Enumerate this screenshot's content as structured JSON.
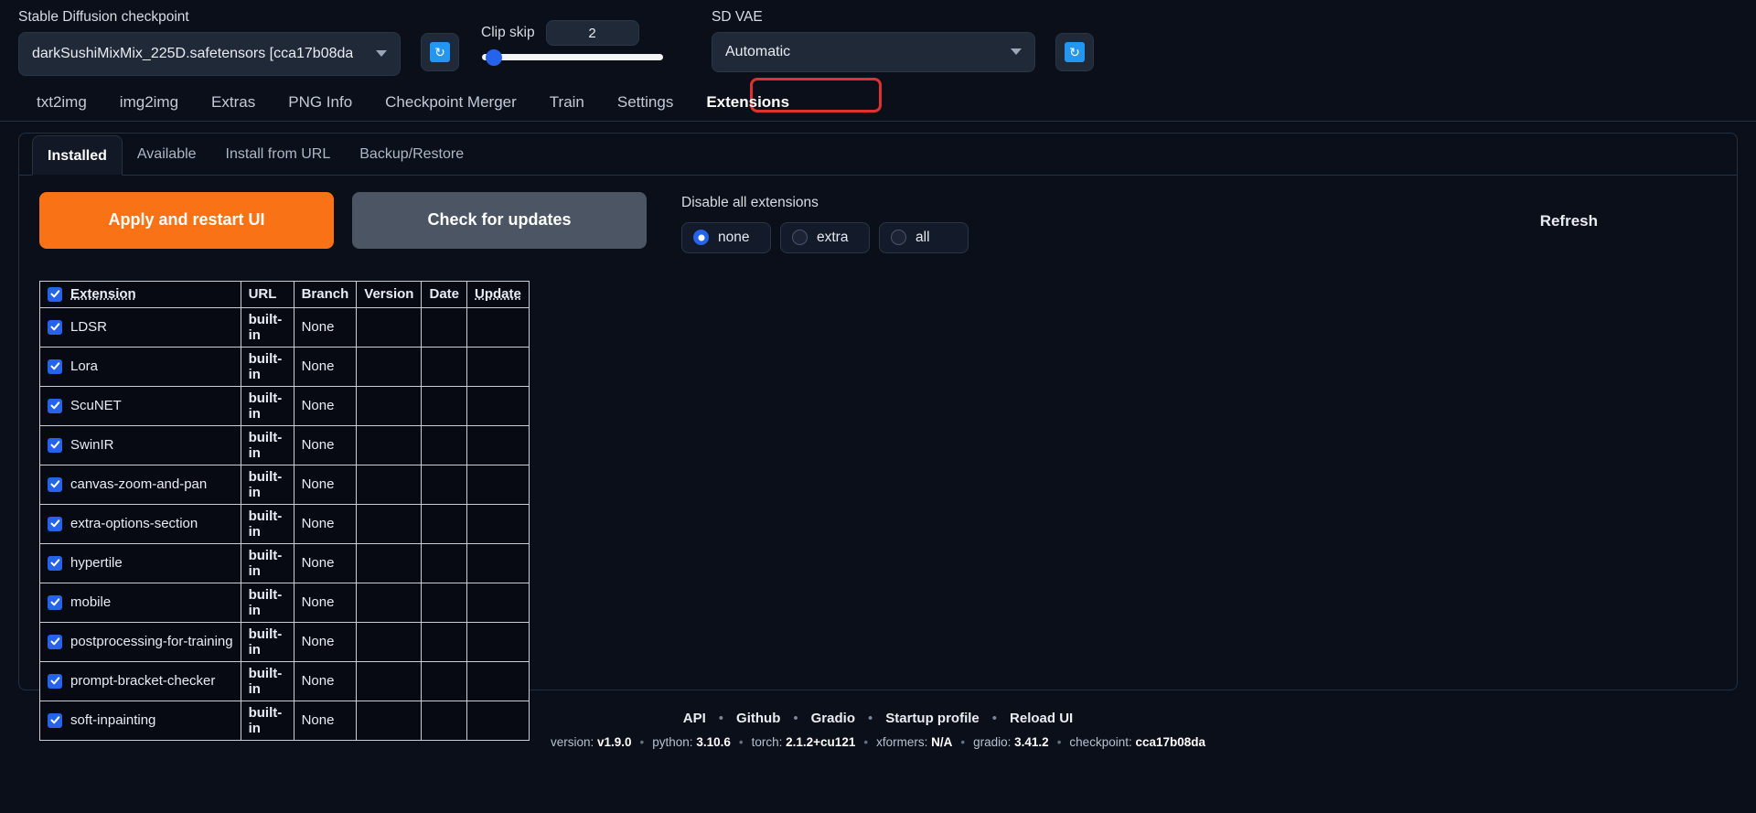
{
  "topbar": {
    "checkpoint_label": "Stable Diffusion checkpoint",
    "checkpoint_value": "darkSushiMixMix_225D.safetensors [cca17b08da",
    "checkpoint_refresh_icon": "refresh-icon",
    "clip_skip_label": "Clip skip",
    "clip_skip_value": "2",
    "vae_label": "SD VAE",
    "vae_value": "Automatic",
    "vae_refresh_icon": "refresh-icon"
  },
  "main_tabs": [
    {
      "label": "txt2img",
      "active": false
    },
    {
      "label": "img2img",
      "active": false
    },
    {
      "label": "Extras",
      "active": false
    },
    {
      "label": "PNG Info",
      "active": false
    },
    {
      "label": "Checkpoint Merger",
      "active": false
    },
    {
      "label": "Train",
      "active": false
    },
    {
      "label": "Settings",
      "active": false
    },
    {
      "label": "Extensions",
      "active": true
    }
  ],
  "highlight_color": "#e03131",
  "sub_tabs": [
    {
      "label": "Installed",
      "active": true
    },
    {
      "label": "Available",
      "active": false
    },
    {
      "label": "Install from URL",
      "active": false
    },
    {
      "label": "Backup/Restore",
      "active": false
    }
  ],
  "actions": {
    "apply_label": "Apply and restart UI",
    "check_updates_label": "Check for updates",
    "apply_color": "#f97316",
    "disable_all_label": "Disable all extensions",
    "disable_options": [
      {
        "label": "none",
        "selected": true
      },
      {
        "label": "extra",
        "selected": false
      },
      {
        "label": "all",
        "selected": false
      }
    ],
    "refresh_label": "Refresh"
  },
  "table": {
    "headers": [
      "Extension",
      "URL",
      "Branch",
      "Version",
      "Date",
      "Update"
    ],
    "header_checked": true,
    "rows": [
      {
        "checked": true,
        "name": "LDSR",
        "url": "built-in",
        "branch": "None",
        "version": "",
        "date": "",
        "update": ""
      },
      {
        "checked": true,
        "name": "Lora",
        "url": "built-in",
        "branch": "None",
        "version": "",
        "date": "",
        "update": ""
      },
      {
        "checked": true,
        "name": "ScuNET",
        "url": "built-in",
        "branch": "None",
        "version": "",
        "date": "",
        "update": ""
      },
      {
        "checked": true,
        "name": "SwinIR",
        "url": "built-in",
        "branch": "None",
        "version": "",
        "date": "",
        "update": ""
      },
      {
        "checked": true,
        "name": "canvas-zoom-and-pan",
        "url": "built-in",
        "branch": "None",
        "version": "",
        "date": "",
        "update": ""
      },
      {
        "checked": true,
        "name": "extra-options-section",
        "url": "built-in",
        "branch": "None",
        "version": "",
        "date": "",
        "update": ""
      },
      {
        "checked": true,
        "name": "hypertile",
        "url": "built-in",
        "branch": "None",
        "version": "",
        "date": "",
        "update": ""
      },
      {
        "checked": true,
        "name": "mobile",
        "url": "built-in",
        "branch": "None",
        "version": "",
        "date": "",
        "update": ""
      },
      {
        "checked": true,
        "name": "postprocessing-for-training",
        "url": "built-in",
        "branch": "None",
        "version": "",
        "date": "",
        "update": ""
      },
      {
        "checked": true,
        "name": "prompt-bracket-checker",
        "url": "built-in",
        "branch": "None",
        "version": "",
        "date": "",
        "update": ""
      },
      {
        "checked": true,
        "name": "soft-inpainting",
        "url": "built-in",
        "branch": "None",
        "version": "",
        "date": "",
        "update": ""
      }
    ]
  },
  "footer": {
    "links": [
      "API",
      "Github",
      "Gradio",
      "Startup profile",
      "Reload UI"
    ],
    "separator": "•",
    "meta": [
      {
        "key": "version:",
        "value": "v1.9.0"
      },
      {
        "key": "python:",
        "value": "3.10.6"
      },
      {
        "key": "torch:",
        "value": "2.1.2+cu121"
      },
      {
        "key": "xformers:",
        "value": "N/A"
      },
      {
        "key": "gradio:",
        "value": "3.41.2"
      },
      {
        "key": "checkpoint:",
        "value": "cca17b08da"
      }
    ]
  }
}
